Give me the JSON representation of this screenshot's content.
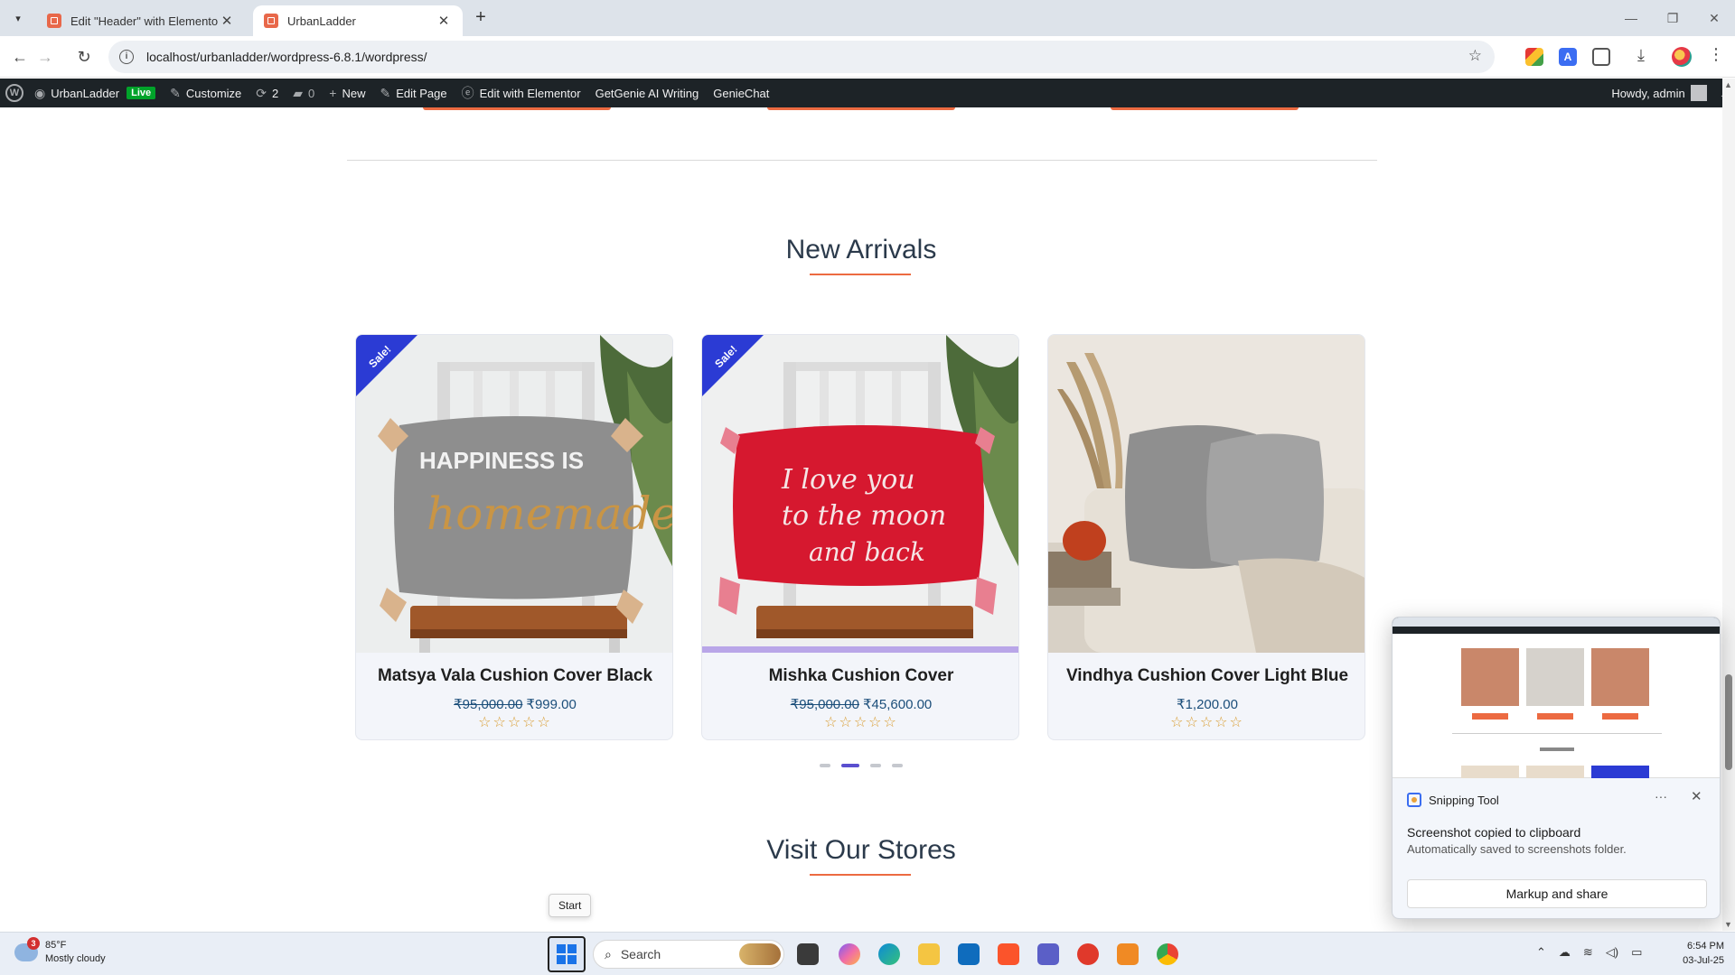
{
  "browser": {
    "tabs": [
      {
        "title": "Edit \"Header\" with Elementor"
      },
      {
        "title": "UrbanLadder"
      }
    ],
    "url": "localhost/urbanladder/wordpress-6.8.1/wordpress/"
  },
  "admin_bar": {
    "site_name": "UrbanLadder",
    "live_badge": "Live",
    "customize": "Customize",
    "updates_count": "2",
    "comments_count": "0",
    "new": "New",
    "edit_page": "Edit Page",
    "edit_elementor": "Edit with Elementor",
    "getgenie": "GetGenie AI Writing",
    "geniechat": "GenieChat",
    "howdy": "Howdy, admin"
  },
  "new_arrivals": {
    "title": "New Arrivals",
    "products": [
      {
        "name": "Matsya Vala Cushion Cover Black",
        "old_price": "₹95,000.00",
        "price": "₹999.00",
        "sale": true,
        "sale_label": "Sale!",
        "rating_stars": "☆☆☆☆☆"
      },
      {
        "name": "Mishka Cushion Cover",
        "old_price": "₹95,000.00",
        "price": "₹45,600.00",
        "sale": true,
        "sale_label": "Sale!",
        "rating_stars": "☆☆☆☆☆"
      },
      {
        "name": "Vindhya Cushion Cover Light Blue",
        "old_price": "",
        "price": "₹1,200.00",
        "sale": false,
        "rating_stars": "☆☆☆☆☆"
      }
    ],
    "carousel_pages": 4,
    "carousel_active": 2
  },
  "stores": {
    "title": "Visit Our Stores"
  },
  "tooltip": "Start",
  "snipping_toast": {
    "app": "Snipping Tool",
    "more": "···",
    "title": "Screenshot copied to clipboard",
    "body": "Automatically saved to screenshots folder.",
    "button": "Markup and share"
  },
  "taskbar": {
    "weather_temp": "85°F",
    "weather_desc": "Mostly cloudy",
    "weather_badge": "3",
    "search_placeholder": "Search",
    "time": "6:54 PM",
    "date": "03-Jul-25"
  },
  "colors": {
    "accent": "#ec6a41",
    "sale_ribbon": "#2b3bd4",
    "price": "#1b4e7a",
    "admin_bar": "#1d2327"
  }
}
